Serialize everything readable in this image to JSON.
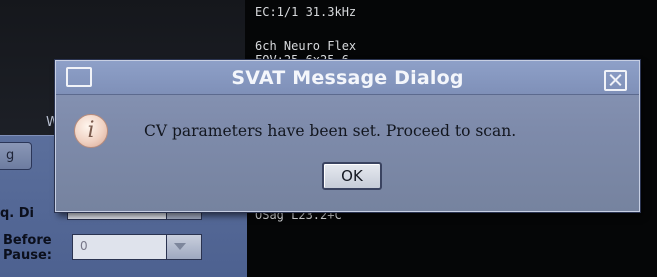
{
  "dialog": {
    "title": "SVAT Message Dialog",
    "message": "CV parameters have been set.  Proceed to scan.",
    "ok_label": "OK",
    "info_glyph": "i",
    "icons": {
      "window": "window-icon",
      "close": "close-icon",
      "info": "info-icon"
    }
  },
  "monitor": {
    "line1": "EC:1/1 31.3kHz",
    "line2": "6ch Neuro Flex",
    "line3": "FOV:25.6x25.6",
    "line4": "OSag L23.2+C"
  },
  "left_panel": {
    "partial_label": "W",
    "partial_button": "g",
    "seq_label": "q. Di",
    "before_label": "Before\nPause:",
    "before_value": "0"
  },
  "colors": {
    "dialog_bg": "#8392b2",
    "title_text": "#f4f6fb",
    "panel_bg": "#5b6f9c",
    "monitor_bg": "#050607"
  }
}
